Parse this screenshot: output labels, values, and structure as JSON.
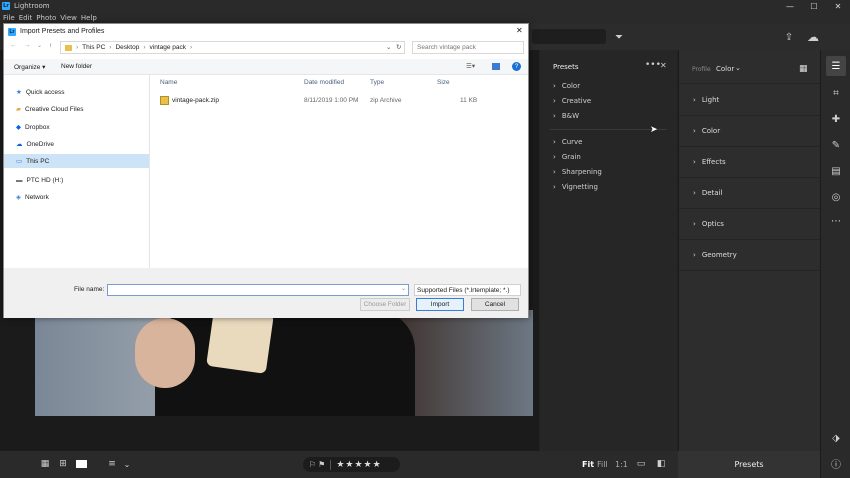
{
  "app": {
    "title": "Lightroom"
  },
  "menu": [
    "File",
    "Edit",
    "Photo",
    "View",
    "Help"
  ],
  "window_controls": {
    "minimize": "—",
    "maximize": "☐",
    "close": "✕"
  },
  "dialog": {
    "title": "Import Presets and Profiles",
    "path": [
      "This PC",
      "Desktop",
      "vintage pack"
    ],
    "search_placeholder": "Search vintage pack",
    "organize": "Organize",
    "new_folder": "New folder",
    "nav_items": [
      "Quick access",
      "Creative Cloud Files",
      "Dropbox",
      "OneDrive",
      "This PC",
      "PTC HD (H:)",
      "Network"
    ],
    "selected_nav": "This PC",
    "columns": [
      "Name",
      "Date modified",
      "Type",
      "Size"
    ],
    "files": [
      {
        "name": "vintage-pack.zip",
        "date": "8/11/2019 1:00 PM",
        "type": "zip Archive",
        "size": "11 KB"
      }
    ],
    "file_name_label": "File name:",
    "file_name_value": "",
    "filter": "Supported Files (*.lrtemplate; *.)",
    "choose_folder": "Choose Folder",
    "import": "Import",
    "cancel": "Cancel"
  },
  "presets_panel": {
    "title": "Presets",
    "group1": [
      "Color",
      "Creative",
      "B&W"
    ],
    "group2": [
      "Curve",
      "Grain",
      "Sharpening",
      "Vignetting"
    ]
  },
  "edit_panel": {
    "profile_label": "Profile",
    "profile_value": "Color",
    "sections": [
      "Light",
      "Color",
      "Effects",
      "Detail",
      "Optics",
      "Geometry"
    ]
  },
  "bottom": {
    "fit": "Fit",
    "fill": "Fill",
    "ratio": "1:1",
    "presets_button": "Presets"
  },
  "colors": {
    "accent": "#31a8ff",
    "panel": "#262626",
    "dialog": "#ffffff"
  }
}
